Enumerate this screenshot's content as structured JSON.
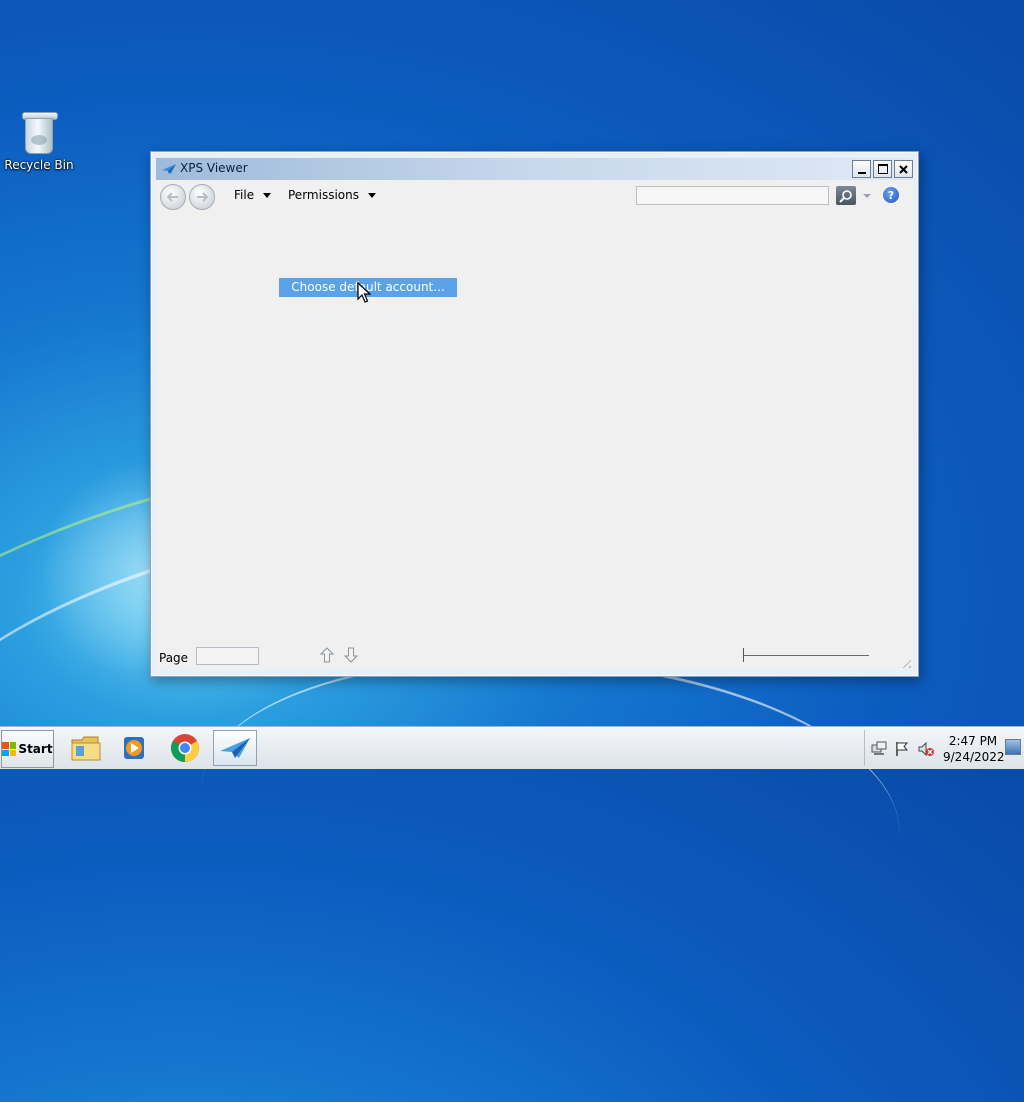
{
  "desktop": {
    "icons": [
      {
        "label": "Recycle Bin",
        "icon": "recycle-bin-icon"
      }
    ]
  },
  "window": {
    "title": "XPS Viewer",
    "controls": {
      "minimize": "minimize-icon",
      "maximize": "maximize-icon",
      "close": "close-icon"
    },
    "toolbar": {
      "back": "back-arrow-icon",
      "forward": "forward-arrow-icon",
      "menus": [
        {
          "label": "File"
        },
        {
          "label": "Permissions"
        }
      ],
      "search": {
        "value": "",
        "placeholder": ""
      },
      "search_button": "search-icon",
      "help": "?"
    },
    "popup_menu": {
      "item": "Choose default account..."
    },
    "statusbar": {
      "page_label": "Page",
      "page_value": "",
      "up": "arrow-up-icon",
      "down": "arrow-down-icon",
      "zoom_slider": "zoom-slider"
    }
  },
  "taskbar": {
    "start_label": "Start",
    "pinned": [
      {
        "name": "Windows Explorer",
        "icon": "folder-icon"
      },
      {
        "name": "Windows Media Player",
        "icon": "media-player-icon"
      },
      {
        "name": "Google Chrome",
        "icon": "chrome-icon"
      },
      {
        "name": "XPS Viewer",
        "icon": "xps-viewer-icon",
        "active": true
      }
    ],
    "tray": {
      "icons": [
        "network-icon",
        "action-center-flag-icon",
        "volume-muted-icon"
      ],
      "time": "2:47 PM",
      "date": "9/24/2022"
    }
  },
  "colors": {
    "desktop_blue": "#0c5cbf",
    "menu_highlight": "#5aa3ea",
    "window_bg": "#f0f0f0"
  }
}
